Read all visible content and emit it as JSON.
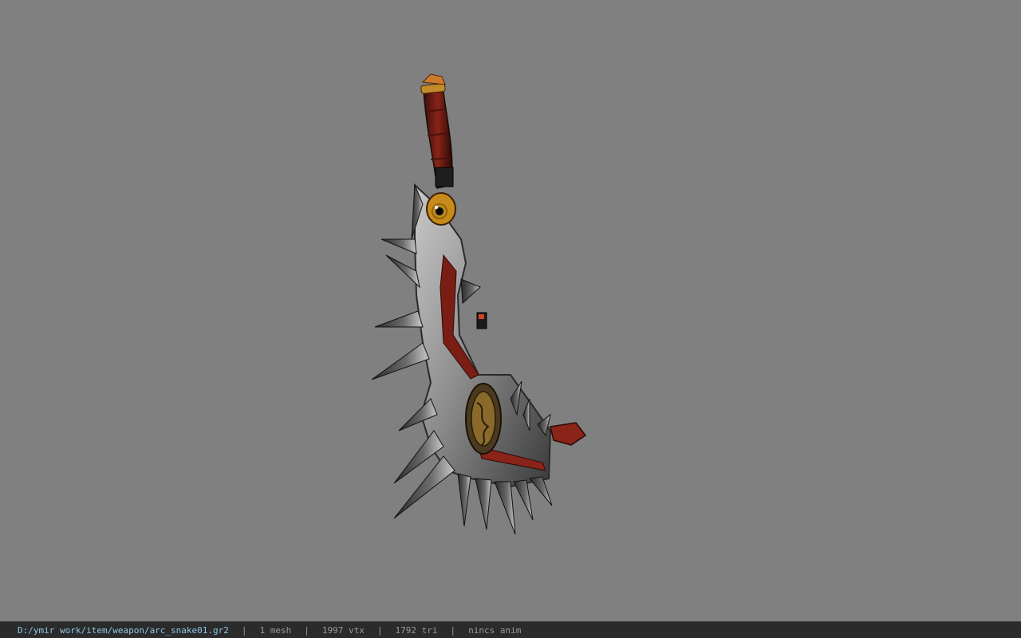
{
  "viewer": {
    "background_color": "#808080",
    "model_icon": "arc-snake-weapon-model"
  },
  "statusbar": {
    "file_path": "D:/ymir work/item/weapon/arc_snake01.gr2",
    "separator": "|",
    "mesh_count": "1 mesh",
    "vertex_count": "1997 vtx",
    "triangle_count": "1792 tri",
    "animation": "nincs anim"
  }
}
